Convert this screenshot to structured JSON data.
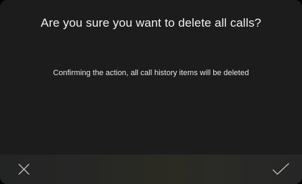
{
  "dialog": {
    "title": "Are you sure you want to delete all calls?",
    "message": "Confirming the action, all call history items will be deleted"
  },
  "actions": {
    "cancel_icon": "close-icon",
    "confirm_icon": "check-icon"
  },
  "colors": {
    "background": "#1c1c1c",
    "action_bar": "#262626",
    "text": "#f2f2f2",
    "icon": "#bfbfbf"
  }
}
